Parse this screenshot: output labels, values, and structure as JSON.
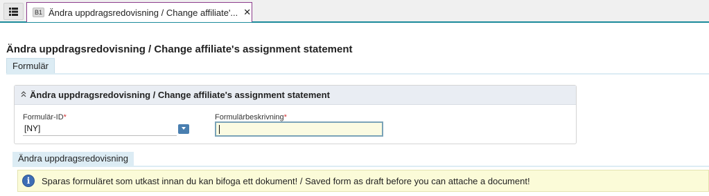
{
  "tabbar": {
    "menu_icon": "list-icon",
    "tab": {
      "badge": "B1",
      "title": "Ändra uppdragsredovisning / Change affiliate'...",
      "close": "✕"
    }
  },
  "page": {
    "title": "Ändra uppdragsredovisning / Change affiliate's assignment statement"
  },
  "section_tab": {
    "label": "Formulär"
  },
  "panel": {
    "collapse_icon": "⌃⌃",
    "header": "Ändra uppdragsredovisning / Change affiliate's assignment statement",
    "fields": {
      "form_id": {
        "label": "Formulär-ID",
        "required": "*",
        "value": "[NY]"
      },
      "form_desc": {
        "label": "Formulärbeskrivning",
        "required": "*",
        "value": ""
      }
    }
  },
  "sub_tab": {
    "label": "Ändra uppdragsredovisning"
  },
  "info": {
    "icon": "info-icon",
    "message": "Sparas formuläret som utkast innan du kan bifoga ett dokument! / Saved form as draft before you can attache a document!"
  },
  "colors": {
    "accent": "#1a8a9a",
    "tab_border": "#8a3a8a",
    "section_bg": "#dcecf4",
    "info_bg": "#fbfbd8",
    "required": "#d03030"
  }
}
